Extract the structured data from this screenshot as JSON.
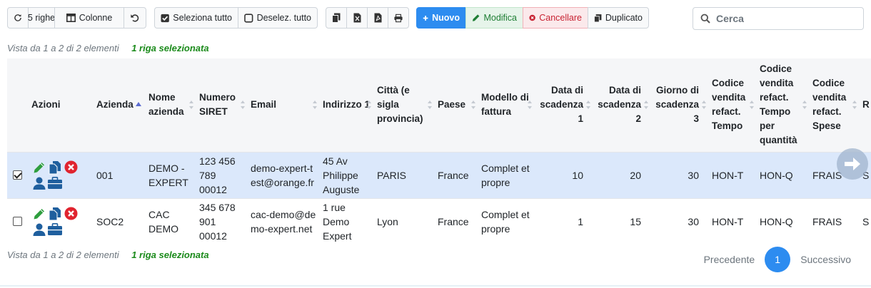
{
  "toolbar": {
    "rows_label": "5 righe",
    "columns_label": "Colonne",
    "select_all_label": "Seleziona tutto",
    "deselect_all_label": "Deselez. tutto",
    "new_label": "Nuovo",
    "edit_label": "Modifica",
    "delete_label": "Cancellare",
    "duplicate_label": "Duplicato"
  },
  "search": {
    "placeholder": "Cerca"
  },
  "info": {
    "range_text": "Vista da 1 a 2 di 2 elementi",
    "selected_text": "1 riga selezionata"
  },
  "table": {
    "headers": {
      "azioni": "Azioni",
      "azienda": "Azienda",
      "nome_azienda": "Nome azienda",
      "siret": "Numero SIRET",
      "email": "Email",
      "indirizzo": "Indirizzo 1",
      "citta": "Città (e sigla provincia)",
      "paese": "Paese",
      "modello": "Modello di fattura",
      "scadenza1": "Data di scadenza 1",
      "scadenza2": "Data di scadenza 2",
      "giorno": "Giorno di scadenza 3",
      "cod_tempo": "Codice vendita refact. Tempo",
      "cod_tempo_qty": "Codice vendita refact. Tempo per quantità",
      "cod_spese": "Codice vendita refact. Spese",
      "extra": "R g"
    },
    "rows": [
      {
        "selected": true,
        "azienda": "001",
        "nome_azienda": "DEMO - EXPERT",
        "siret": "123 456 789 00012",
        "email": "demo-expert-test@orange.fr",
        "indirizzo": "45 Av Philippe Auguste",
        "citta": "PARIS",
        "paese": "France",
        "modello": "Complet et propre",
        "scadenza1": "10",
        "scadenza2": "20",
        "giorno": "30",
        "cod_tempo": "HON-T",
        "cod_tempo_qty": "HON-Q",
        "cod_spese": "FRAIS",
        "extra": "S"
      },
      {
        "selected": false,
        "azienda": "SOC2",
        "nome_azienda": "CAC DEMO",
        "siret": "345 678 901 00012",
        "email": "cac-demo@demo-expert.net",
        "indirizzo": "1 rue Demo Expert",
        "citta": "Lyon",
        "paese": "France",
        "modello": "Complet et propre",
        "scadenza1": "1",
        "scadenza2": "15",
        "giorno": "30",
        "cod_tempo": "HON-T",
        "cod_tempo_qty": "HON-Q",
        "cod_spese": "FRAIS",
        "extra": "S"
      }
    ]
  },
  "pagination": {
    "prev_label": "Precedente",
    "current_page": "1",
    "next_label": "Successivo"
  },
  "colors": {
    "primary": "#2d8cf0",
    "selected_row": "#dbe8fb",
    "selected_text": "#1a8a1a",
    "edit_icon": "#2e9e3e",
    "doc_icon": "#1f5f9e",
    "delete_icon": "#e0242f"
  }
}
